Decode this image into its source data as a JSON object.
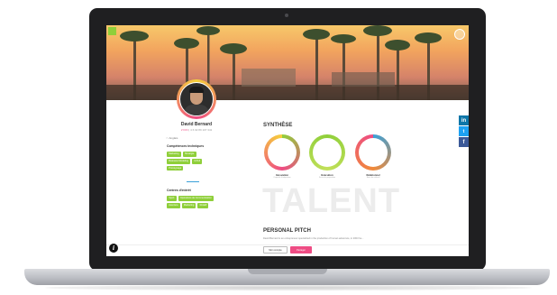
{
  "profile": {
    "name": "David Bernard",
    "subline_highlight": "LYON",
    "subline_rest": " | 4 6 02 89 107 341",
    "language": "Anglais"
  },
  "skills": {
    "title": "Compétences techniques",
    "tags": [
      "Marketing",
      "Stratégie",
      "Business Modeling",
      "UX/UI",
      "Prototypage"
    ]
  },
  "interests": {
    "title": "Centres d'intérêt",
    "tags": [
      "Sport",
      "Opérations de Communication",
      "Aventure",
      "Marketing",
      "Rotatif"
    ]
  },
  "synthesis": {
    "title": "SYNTHÈSE",
    "rings": [
      {
        "label": "Innovation",
        "sub": "Capacité d'adaptation",
        "colors": [
          "#8fcf3a",
          "#ee4c84",
          "#f6d03a"
        ]
      },
      {
        "label": "Exécution",
        "sub": "Force de proposition",
        "colors": [
          "#8fcf3a",
          "#c2e05a",
          "#8fcf3a"
        ]
      },
      {
        "label": "Relationnel",
        "sub": "Sens du collectif",
        "colors": [
          "#3aa0d8",
          "#f08a3a",
          "#ee4c84"
        ]
      }
    ]
  },
  "talent_watermark": "TALENT",
  "pitch": {
    "title": "PERSONAL PITCH",
    "text": "David Bernard is an entrepreneur specialized in the production of human adventure, in 2003 he..."
  },
  "social": {
    "linkedin": "in",
    "twitter": "t",
    "facebook": "f"
  },
  "footer": {
    "contact_label": "Mon compte",
    "share_label": "Partager",
    "info_glyph": "i"
  },
  "colors": {
    "accent_green": "#8fcf3a",
    "accent_pink": "#ee4c84",
    "laptop_bezel": "#1f1f21"
  }
}
